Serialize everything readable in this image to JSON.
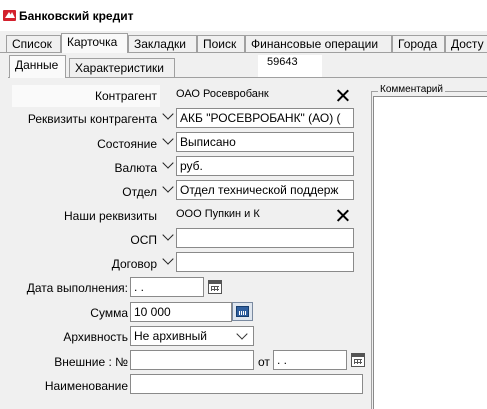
{
  "window": {
    "title": "Банковский кредит",
    "logo_icon": "bank-logo-icon"
  },
  "tabs": [
    {
      "label": "Список",
      "active": false
    },
    {
      "label": "Карточка",
      "active": true
    },
    {
      "label": "Закладки",
      "active": false
    },
    {
      "label": "Поиск",
      "active": false
    },
    {
      "label": "Финансовые операции",
      "active": false
    },
    {
      "label": "Города",
      "active": false
    },
    {
      "label": "Досту",
      "active": false
    }
  ],
  "subtabs": [
    {
      "label": "Данные",
      "active": true
    },
    {
      "label": "Характеристики",
      "active": false
    }
  ],
  "record_id": "59643",
  "form": {
    "contragent": {
      "label": "Контрагент",
      "value": "ОАО Росевробанк"
    },
    "contragent_details": {
      "label": "Реквизиты контрагента",
      "value": "АКБ \"РОСЕВРОБАНК\" (АО) ("
    },
    "state": {
      "label": "Состояние",
      "value": "Выписано"
    },
    "currency": {
      "label": "Валюта",
      "value": "руб."
    },
    "department": {
      "label": "Отдел",
      "value": "Отдел технической поддерж"
    },
    "our_details": {
      "label": "Наши реквизиты",
      "value": "ООО Пупкин и К"
    },
    "osp": {
      "label": "ОСП",
      "value": ""
    },
    "contract": {
      "label": "Договор",
      "value": ""
    },
    "exec_date": {
      "label": "Дата выполнения:",
      "value": " .  ."
    },
    "amount": {
      "label": "Сумма",
      "value": "10 000"
    },
    "archive": {
      "label": "Архивность",
      "value": "Не архивный"
    },
    "external": {
      "label": "Внешние : №",
      "value": "",
      "from_label": "от",
      "from_value": " .  ."
    },
    "name": {
      "label": "Наименование",
      "value": ""
    }
  },
  "comment": {
    "label": "Комментарий",
    "value": ""
  }
}
